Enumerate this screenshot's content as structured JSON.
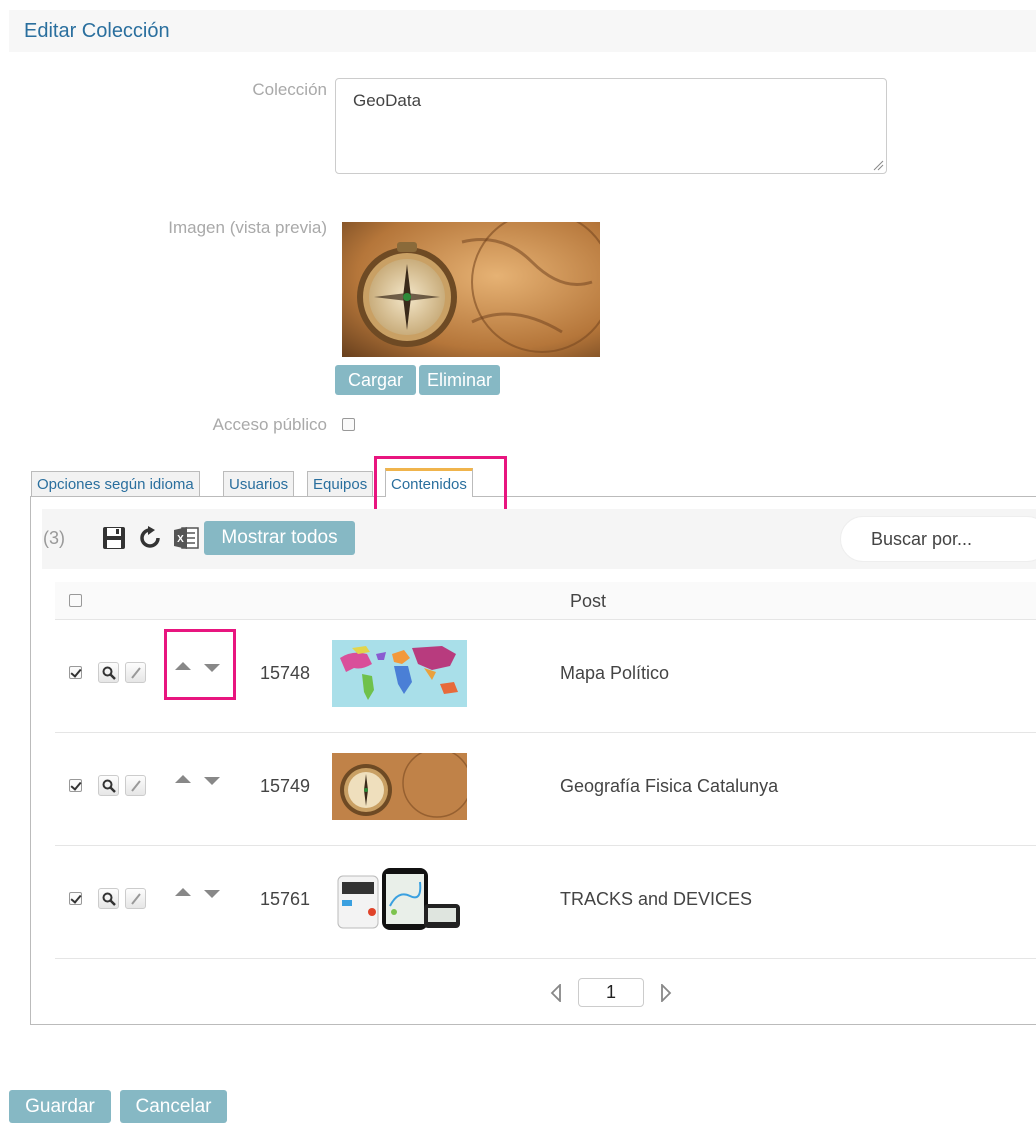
{
  "header": {
    "title": "Editar Colección"
  },
  "form": {
    "coleccion_label": "Colección",
    "coleccion_value": "GeoData",
    "imagen_label": "Imagen (vista previa)",
    "cargar_label": "Cargar",
    "eliminar_label": "Eliminar",
    "acceso_label": "Acceso público",
    "acceso_checked": false
  },
  "tabs": [
    {
      "label": "Opciones según idioma",
      "active": false
    },
    {
      "label": "Usuarios",
      "active": false
    },
    {
      "label": "Equipos",
      "active": false
    },
    {
      "label": "Contenidos",
      "active": true
    }
  ],
  "toolbar": {
    "count": "(3)",
    "icons": [
      "save-icon",
      "refresh-icon",
      "excel-icon"
    ],
    "mostrar_todos_label": "Mostrar todos",
    "search_placeholder": "Buscar por..."
  },
  "table": {
    "column_post": "Post",
    "rows": [
      {
        "id": "15748",
        "title": "Mapa Político",
        "checked": true,
        "thumb": "world-map"
      },
      {
        "id": "15749",
        "title": "Geografía Fisica Catalunya",
        "checked": true,
        "thumb": "compass-map"
      },
      {
        "id": "15761",
        "title": "TRACKS and DEVICES",
        "checked": true,
        "thumb": "devices"
      }
    ]
  },
  "pager": {
    "page": "1"
  },
  "footer": {
    "guardar_label": "Guardar",
    "cancelar_label": "Cancelar"
  },
  "colors": {
    "accent": "#86b8c4",
    "title": "#2a6f9e",
    "highlight": "#e8157f",
    "active_tab": "#f0b44c"
  }
}
